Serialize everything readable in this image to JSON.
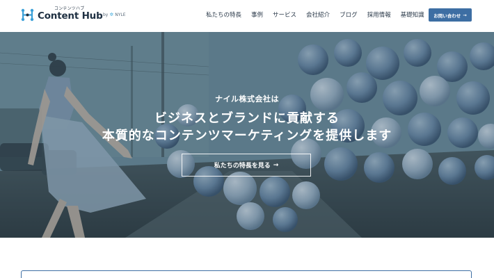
{
  "header": {
    "logo_small": "コンテンツハブ",
    "logo_main": "Content Hub",
    "by_label": "by",
    "partner_name": "NYLE",
    "nav": [
      {
        "label": "私たちの特長"
      },
      {
        "label": "事例"
      },
      {
        "label": "サービス"
      },
      {
        "label": "会社紹介"
      },
      {
        "label": "ブログ"
      },
      {
        "label": "採用情報"
      },
      {
        "label": "基礎知識"
      }
    ],
    "contact_label": "お問い合わせ",
    "contact_arrow": "→"
  },
  "hero": {
    "company": "ナイル株式会社は",
    "line1": "ビジネスとブランドに貢献する",
    "line2": "本質的なコンテンツマーケティングを提供します",
    "cta_label": "私たちの特長を見る",
    "cta_arrow": "→"
  },
  "colors": {
    "accent": "#3d6ea3",
    "text": "#2b3a4a",
    "logo_icon": "#3aa0d8"
  }
}
